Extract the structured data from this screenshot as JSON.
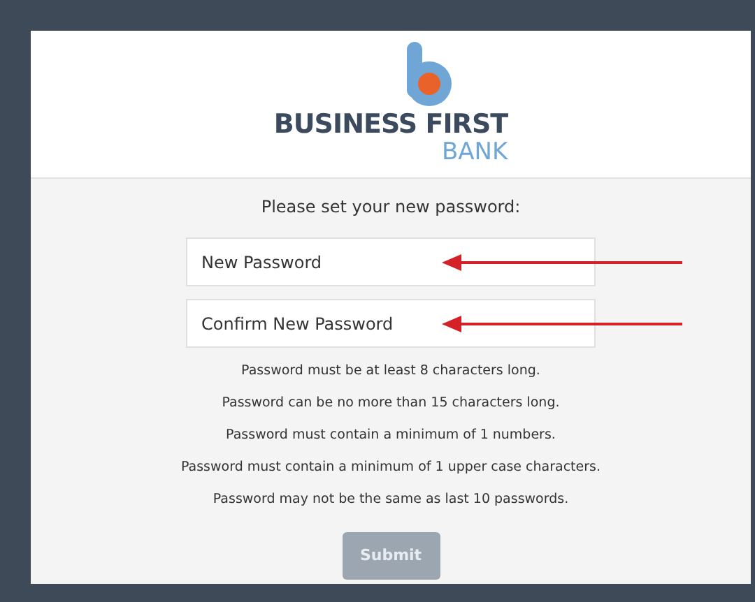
{
  "logo": {
    "name": "BUSINESS FIRST",
    "subname": "BANK"
  },
  "prompt": "Please set your new password:",
  "fields": [
    {
      "placeholder": "New Password"
    },
    {
      "placeholder": "Confirm New Password"
    }
  ],
  "rules": [
    "Password must be at least 8 characters long.",
    "Password can be no more than 15 characters long.",
    "Password must contain a minimum of 1 numbers.",
    "Password must contain a minimum of 1 upper case characters.",
    "Password may not be the same as last 10 passwords."
  ],
  "submit": {
    "label": "Submit",
    "disabled": true
  }
}
